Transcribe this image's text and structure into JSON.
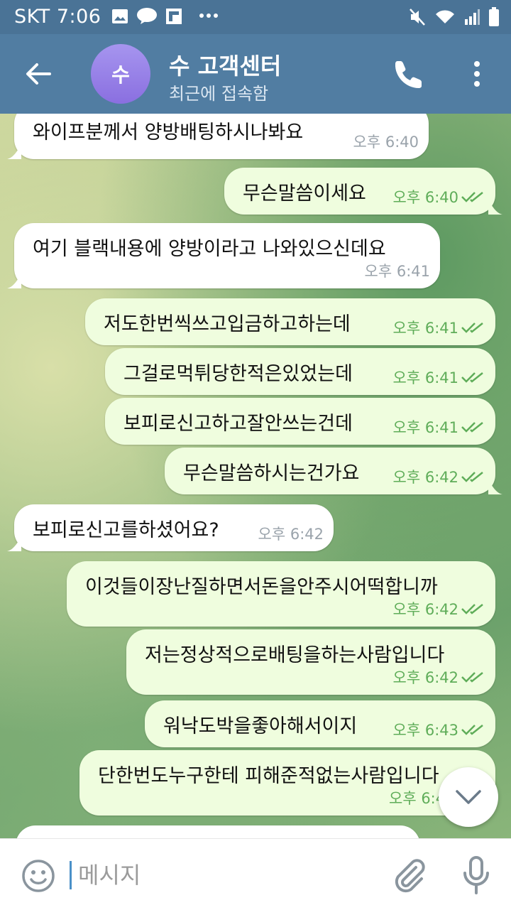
{
  "status_bar": {
    "carrier_time": "SKT 7:06"
  },
  "header": {
    "avatar_letter": "수",
    "title": "수 고객센터",
    "status": "최근에 접속함"
  },
  "messages": [
    {
      "dir": "in",
      "text": "와이프분께서 양방배팅하시나봐요",
      "time": "오후 6:40"
    },
    {
      "dir": "out",
      "text": "무슨말씀이세요",
      "time": "오후 6:40",
      "read": true
    },
    {
      "dir": "in",
      "text": "여기 블랙내용에 양방이라고 나와있으신데요",
      "time": "오후 6:41"
    },
    {
      "dir": "out",
      "text": "저도한번씩쓰고입금하고하는데",
      "time": "오후 6:41",
      "read": true
    },
    {
      "dir": "out",
      "text": "그걸로먹튀당한적은있었는데",
      "time": "오후 6:41",
      "read": true
    },
    {
      "dir": "out",
      "text": "보피로신고하고잘안쓰는건데",
      "time": "오후 6:41",
      "read": true
    },
    {
      "dir": "out",
      "text": "무슨말씀하시는건가요",
      "time": "오후 6:42",
      "read": true
    },
    {
      "dir": "in",
      "text": "보피로신고를하셨어요?",
      "time": "오후 6:42"
    },
    {
      "dir": "out",
      "text": "이것들이장난질하면서돈을안주시어떡합니까",
      "time": "오후 6:42",
      "read": true
    },
    {
      "dir": "out",
      "text": "저는정상적으로배팅을하는사람입니다",
      "time": "오후 6:42",
      "read": true
    },
    {
      "dir": "out",
      "text": "워낙도박을좋아해서이지",
      "time": "오후 6:43",
      "read": true
    },
    {
      "dir": "out",
      "text": "단한번도누구한테 피해준적없는사람입니다",
      "time": "오후 6:4",
      "read": true
    }
  ],
  "input": {
    "placeholder": "메시지"
  },
  "icons": {
    "back": "arrow-left-icon",
    "call": "phone-icon",
    "menu": "more-vertical-icon",
    "emoji": "smile-icon",
    "attach": "paperclip-icon",
    "mic": "microphone-icon",
    "scroll": "chevron-down-icon",
    "read": "double-check-icon"
  },
  "colors": {
    "header": "#517da2",
    "status_bar": "#4a7396",
    "out_bubble": "#effdde",
    "in_bubble": "#ffffff",
    "tick": "#5fad59",
    "avatar": "#8a6fe0"
  }
}
